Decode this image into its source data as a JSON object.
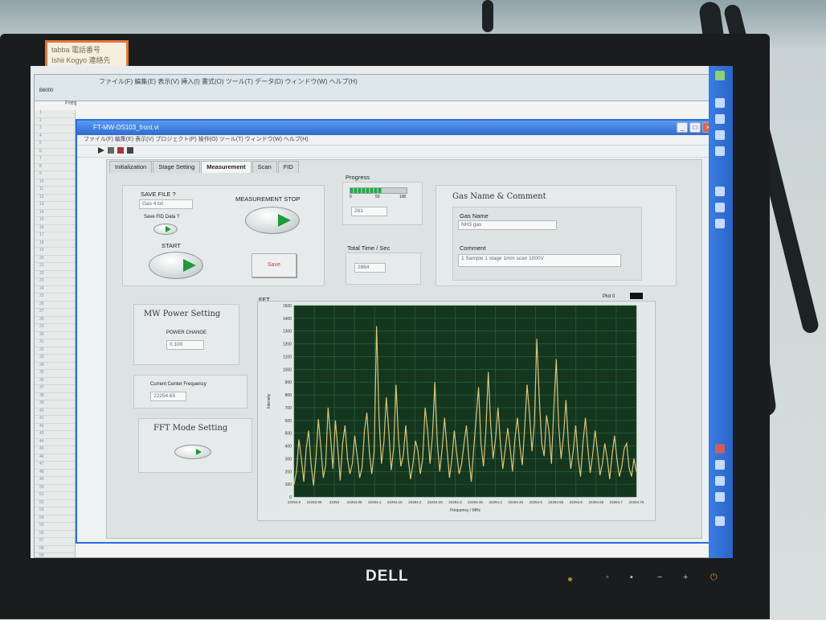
{
  "sticky_note": [
    "tabba 電話番号",
    "Ishii Kogyo 連絡先"
  ],
  "monitor_brand": "DELL",
  "excel": {
    "menu": "ファイル(F)  編集(E)  表示(V)  挿入(I)  書式(O)  ツール(T)  データ(D)  ウィンドウ(W)  ヘルプ(H)",
    "cell_ref": "B6000",
    "column_header": "Freq",
    "row_numbers": [
      "1",
      "2",
      "3",
      "4",
      "5",
      "6",
      "7",
      "8",
      "9",
      "10",
      "11",
      "12",
      "13",
      "14",
      "15",
      "16",
      "17",
      "18",
      "19",
      "20",
      "21",
      "22",
      "23",
      "24",
      "25",
      "26",
      "27",
      "28",
      "29",
      "30",
      "31",
      "32",
      "33",
      "34",
      "35",
      "36",
      "37",
      "38",
      "39",
      "40",
      "41",
      "42",
      "43",
      "44",
      "45",
      "46",
      "47",
      "48",
      "49",
      "50",
      "51",
      "52",
      "53",
      "54",
      "55",
      "56",
      "57",
      "58",
      "59"
    ]
  },
  "labview": {
    "title": "FT-MW-DS103_front.vi",
    "menu": "ファイル(F)  編集(E)  表示(V)  プロジェクト(P)  操作(O)  ツール(T)  ウィンドウ(W)  ヘルプ(H)",
    "tabs": [
      "Initialization",
      "Stage Setting",
      "Measurement",
      "Scan",
      "FID"
    ],
    "active_tab": "Measurement",
    "save_file_label": "SAVE FILE ?",
    "save_file_value": "Gas 4.txt",
    "save_fid_label": "Save FID Data ?",
    "start_label": "START",
    "measurement_stop_label": "MEASUREMENT STOP",
    "save_button_label": "Save",
    "progress_label": "Progress",
    "progress_fraction": 0.55,
    "progress_scale": [
      "0",
      "50",
      "100"
    ],
    "progress_value": "261",
    "total_time_label": "Total Time / Sec",
    "total_time_value": "2864",
    "gas_name_comment_label": "Gas Name & Comment",
    "gas_name_label": "Gas Name",
    "gas_name_value": "NH3 gas",
    "comment_label": "Comment",
    "comment_value": "1 Sample 1 stage 1mm scan 1000V",
    "mw_power_label": "MW Power Setting",
    "power_change_label": "POWER CHANGE",
    "power_value": "0.100",
    "center_freq_label": "Current Center Frequency",
    "center_freq_value": "22254.65",
    "fft_mode_label": "FFT Mode Setting",
    "chart_title": "FFT",
    "plot_legend": "Plot 0",
    "colors": {
      "plot_bg": "#14361f",
      "grid": "#2f6b3e",
      "trace": "#d8c57a",
      "window_border": "#2b6cd6"
    }
  },
  "chart_data": {
    "type": "line",
    "title": "FFT",
    "xlabel": "Frequency / MHz",
    "ylabel": "Intensity",
    "xlim": [
      22253.9,
      22254.75
    ],
    "ylim": [
      0,
      1500
    ],
    "x_ticks": [
      "22253.9",
      "22253.95",
      "22254",
      "22254.05",
      "22254.1",
      "22254.15",
      "22254.2",
      "22254.25",
      "22254.3",
      "22254.35",
      "22254.4",
      "22254.45",
      "22254.5",
      "22254.55",
      "22254.6",
      "22254.65",
      "22254.7",
      "22254.75"
    ],
    "y_ticks": [
      "0",
      "100",
      "200",
      "300",
      "400",
      "500",
      "600",
      "700",
      "800",
      "900",
      "1000",
      "1100",
      "1200",
      "1300",
      "1400",
      "1500"
    ],
    "grid": true,
    "series": [
      {
        "name": "Plot 0",
        "values": [
          100,
          200,
          450,
          300,
          120,
          380,
          520,
          260,
          90,
          300,
          610,
          400,
          150,
          250,
          700,
          480,
          220,
          600,
          380,
          130,
          420,
          560,
          300,
          180,
          260,
          480,
          320,
          150,
          230,
          520,
          660,
          350,
          180,
          360,
          1340,
          620,
          260,
          430,
          780,
          520,
          210,
          380,
          880,
          460,
          240,
          330,
          560,
          300,
          140,
          260,
          440,
          360,
          180,
          300,
          700,
          520,
          260,
          480,
          900,
          420,
          200,
          380,
          620,
          380,
          150,
          300,
          520,
          340,
          180,
          260,
          420,
          560,
          300,
          120,
          380,
          620,
          860,
          420,
          240,
          520,
          980,
          560,
          300,
          460,
          700,
          420,
          220,
          380,
          540,
          380,
          200,
          460,
          620,
          400,
          250,
          540,
          880,
          640,
          360,
          580,
          1240,
          780,
          420,
          320,
          640,
          520,
          260,
          700,
          1080,
          560,
          300,
          480,
          760,
          420,
          220,
          360,
          560,
          300,
          160,
          420,
          620,
          380,
          190,
          330,
          520,
          360,
          170,
          260,
          420,
          300,
          140,
          330,
          480,
          300,
          160,
          240,
          380,
          420,
          230,
          160,
          300,
          200
        ]
      }
    ]
  }
}
